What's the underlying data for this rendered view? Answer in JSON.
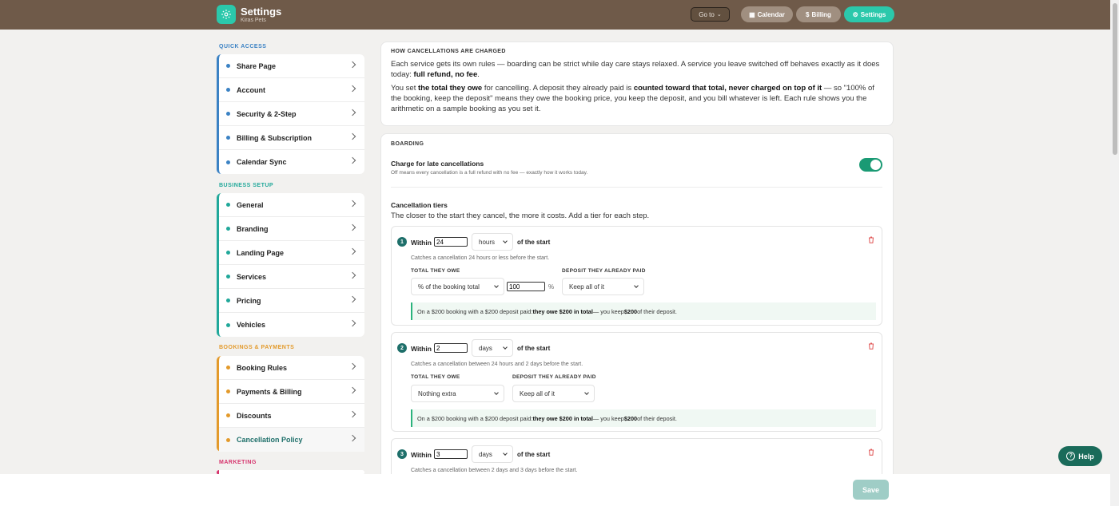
{
  "header": {
    "title": "Settings",
    "subtitle": "Kiras Pets",
    "goto_label": "Go to",
    "nav": [
      "Calendar",
      "Billing",
      "Settings"
    ]
  },
  "sidebar": {
    "groups": [
      {
        "label": "QUICK ACCESS",
        "color": "#3b82c4",
        "items": [
          "Share Page",
          "Account",
          "Security & 2-Step",
          "Billing & Subscription",
          "Calendar Sync"
        ]
      },
      {
        "label": "BUSINESS SETUP",
        "color": "#21a89a",
        "items": [
          "General",
          "Branding",
          "Landing Page",
          "Services",
          "Pricing",
          "Vehicles"
        ]
      },
      {
        "label": "BOOKINGS & PAYMENTS",
        "color": "#e39a2b",
        "items": [
          "Booking Rules",
          "Payments & Billing",
          "Discounts",
          "Cancellation Policy"
        ]
      },
      {
        "label": "MARKETING",
        "color": "#d6336c",
        "items": []
      }
    ],
    "selected": "Cancellation Policy"
  },
  "info": {
    "heading": "HOW CANCELLATIONS ARE CHARGED",
    "p1_a": "Each service gets its own rules — boarding can be strict while day care stays relaxed. A service you leave switched off behaves exactly as it does today: ",
    "p1_b": "full refund, no fee",
    "p1_c": ".",
    "p2_a": "You set ",
    "p2_b": "the total they owe",
    "p2_c": " for cancelling. A deposit they already paid is ",
    "p2_d": "counted toward that total, never charged on top of it",
    "p2_e": " — so \"100% of the booking, keep the deposit\" means they owe the booking price, you keep the deposit, and you bill whatever is left. Each rule shows you the arithmetic on a sample booking as you set it."
  },
  "boarding": {
    "heading": "BOARDING",
    "toggle_title": "Charge for late cancellations",
    "toggle_desc": "Off means every cancellation is a full refund with no fee — exactly how it works today.",
    "toggle_on": true,
    "tiers_title": "Cancellation tiers",
    "tiers_desc": "The closer to the start they cancel, the more it costs. Add a tier for each step.",
    "within_label": "Within",
    "of_start_label": "of the start",
    "owe_header": "TOTAL THEY OWE",
    "deposit_header": "DEPOSIT THEY ALREADY PAID",
    "tiers": [
      {
        "num": "1",
        "value": "24",
        "unit": "hours",
        "desc": "Catches a cancellation 24 hours or less before the start.",
        "owe": "% of the booking total",
        "pct": "100",
        "pct_sign": "%",
        "deposit": "Keep all of it",
        "calc_a": "On a $200 booking with a $200 deposit paid: ",
        "calc_b": "they owe $200 in total",
        "calc_c": " — you keep ",
        "calc_d": "$200",
        "calc_e": " of their deposit."
      },
      {
        "num": "2",
        "value": "2",
        "unit": "days",
        "desc": "Catches a cancellation between 24 hours and 2 days before the start.",
        "owe": "Nothing extra",
        "deposit": "Keep all of it",
        "calc_a": "On a $200 booking with a $200 deposit paid: ",
        "calc_b": "they owe $200 in total",
        "calc_c": " — you keep ",
        "calc_d": "$200",
        "calc_e": " of their deposit."
      },
      {
        "num": "3",
        "value": "3",
        "unit": "days",
        "desc": "Catches a cancellation between 2 days and 3 days before the start."
      }
    ]
  },
  "footer": {
    "save": "Save",
    "help": "Help"
  }
}
